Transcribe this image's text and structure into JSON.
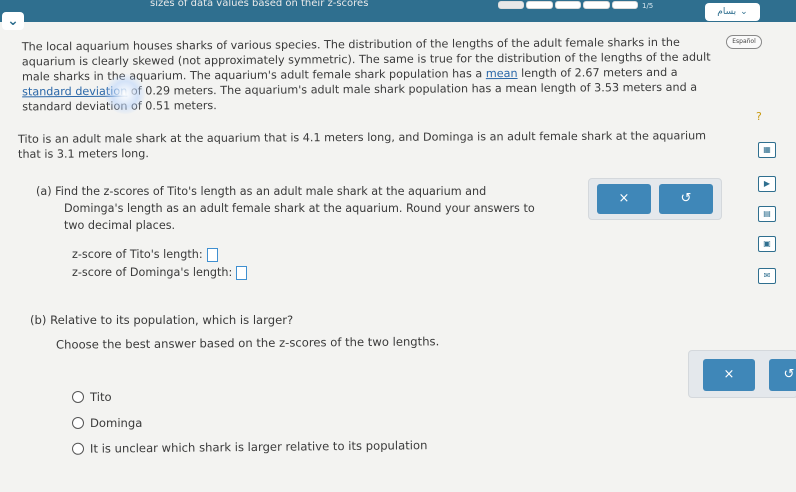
{
  "header": {
    "title": "sizes of data values based on their z-scores",
    "progress_count": "1/5",
    "progress": {
      "completed": 1,
      "total": 5
    },
    "language_label": "بسام",
    "espanol_label": "Español",
    "accent_color": "#2f6f8f"
  },
  "problem": {
    "intro_1": "The local aquarium houses sharks of various species. The distribution of the lengths of the adult female sharks in the aquarium is clearly skewed (not approximately symmetric). The same is true for the distribution of the lengths of the adult male sharks in the aquarium. The aquarium's adult female shark population has a ",
    "mean_link": "mean",
    "intro_2": " length of 2.67 meters and a ",
    "sd_link": "standard deviation",
    "intro_3": " of 0.29 meters. The aquarium's adult male shark population has a mean length of 3.53 meters and a standard deviation of 0.51 meters.",
    "scenario": "Tito is an adult male shark at the aquarium that is 4.1 meters long, and Dominga is an adult female shark at the aquarium that is 3.1 meters long."
  },
  "part_a": {
    "label": "(a)",
    "line1": "Find the z-scores of Tito's length as an adult male shark at the aquarium and",
    "line2": "Dominga's length as an adult female shark at the aquarium. Round your answers to",
    "line3": "two decimal places.",
    "tito_label": "z-score of Tito's length:",
    "dominga_label": "z-score of Dominga's length:",
    "clear_button": "×",
    "undo_button": "↺"
  },
  "part_b": {
    "label": "(b)",
    "question": "Relative to its population, which is larger?",
    "instruction": "Choose the best answer based on the z-scores of the two lengths.",
    "options": [
      "Tito",
      "Dominga",
      "It is unclear which shark is larger relative to its population"
    ],
    "clear_button": "×",
    "undo_button": "↺"
  },
  "sidebar": {
    "help": "?",
    "icons": [
      "calculator-icon",
      "video-icon",
      "data-table-icon",
      "book-icon",
      "mail-icon"
    ]
  }
}
